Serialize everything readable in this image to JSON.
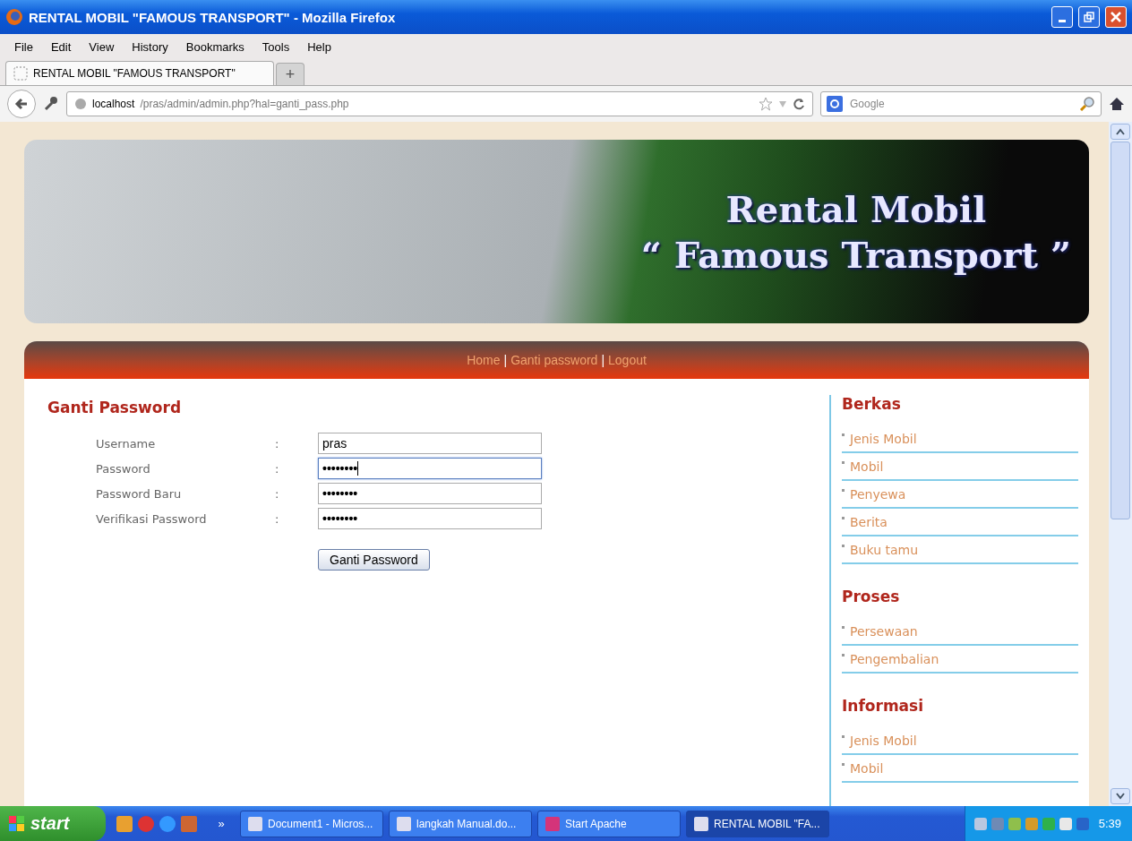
{
  "window": {
    "title": "RENTAL MOBIL \"FAMOUS TRANSPORT\" - Mozilla Firefox"
  },
  "menu": [
    "File",
    "Edit",
    "View",
    "History",
    "Bookmarks",
    "Tools",
    "Help"
  ],
  "tabs": [
    {
      "label": "RENTAL MOBIL \"FAMOUS TRANSPORT\"",
      "selected": true
    }
  ],
  "new_tab": "+",
  "address": {
    "host": "localhost",
    "path": "/pras/admin/admin.php?hal=ganti_pass.php"
  },
  "search": {
    "placeholder": "Google"
  },
  "banner": {
    "line1": "Rental Mobil",
    "line2": "“ Famous Transport ”"
  },
  "nav": [
    {
      "label": "Home"
    },
    {
      "label": "Ganti password"
    },
    {
      "label": "Logout"
    }
  ],
  "nav_separator": "|",
  "form": {
    "title": "Ganti Password",
    "separator": ":",
    "fields": [
      {
        "label": "Username",
        "kind": "text",
        "value": "pras",
        "focused": false
      },
      {
        "label": "Password",
        "kind": "password",
        "value": "••••••••",
        "focused": true
      },
      {
        "label": "Password Baru",
        "kind": "password",
        "value": "••••••••",
        "focused": false
      },
      {
        "label": "Verifikasi Password",
        "kind": "password",
        "value": "••••••••",
        "focused": false
      }
    ],
    "submit": "Ganti Password"
  },
  "sidebar": [
    {
      "title": "Berkas",
      "items": [
        "Jenis Mobil",
        "Mobil",
        "Penyewa",
        "Berita",
        "Buku tamu"
      ]
    },
    {
      "title": "Proses",
      "items": [
        "Persewaan",
        "Pengembalian"
      ]
    },
    {
      "title": "Informasi",
      "items": [
        "Jenis Mobil",
        "Mobil"
      ]
    }
  ],
  "taskbar": {
    "start": "start",
    "overflow": "»",
    "tasks": [
      {
        "label": "Document1 - Micros...",
        "selected": false
      },
      {
        "label": "langkah Manual.do...",
        "selected": false
      },
      {
        "label": "Start Apache",
        "selected": false
      },
      {
        "label": "RENTAL MOBIL \"FA...",
        "selected": true
      }
    ],
    "clock": "5:39"
  }
}
